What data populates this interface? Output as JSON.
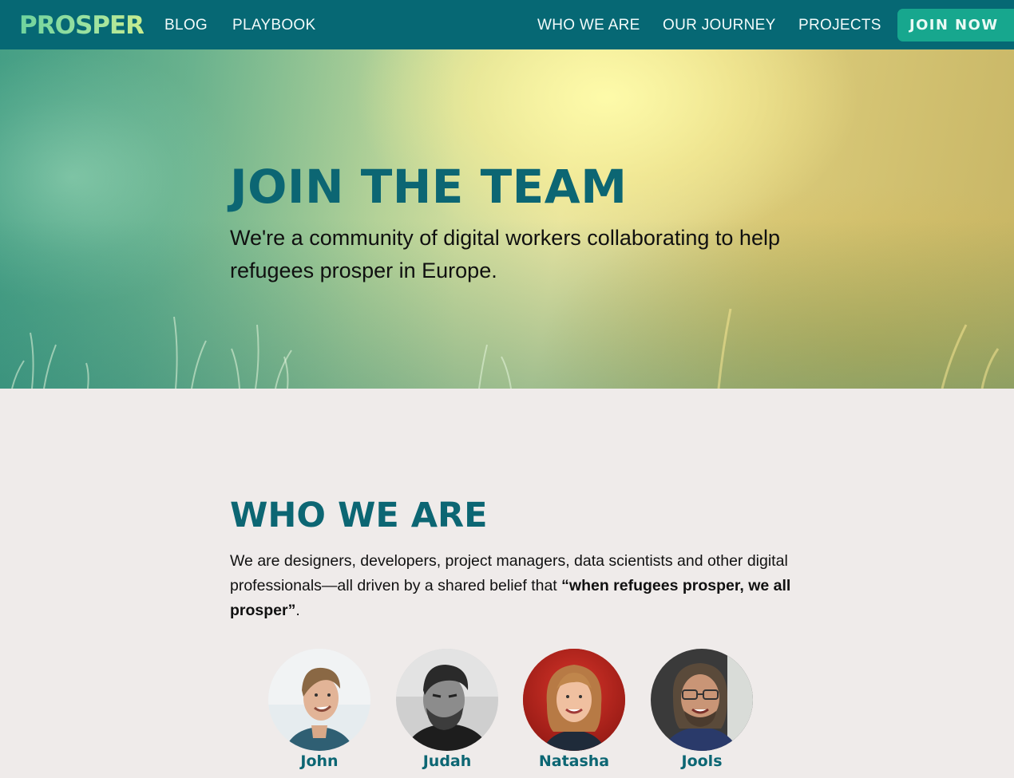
{
  "nav": {
    "logo": "PROSPER",
    "left_links": [
      {
        "label": "BLOG"
      },
      {
        "label": "PLAYBOOK"
      }
    ],
    "right_links": [
      {
        "label": "WHO WE ARE"
      },
      {
        "label": "OUR JOURNEY"
      },
      {
        "label": "PROJECTS"
      }
    ],
    "cta": "JOIN NOW"
  },
  "hero": {
    "title": "JOIN THE TEAM",
    "subtitle": "We're a community of digital workers collaborating to help refugees prosper in Europe."
  },
  "who_we_are": {
    "title": "WHO WE ARE",
    "body_intro": "We are designers, developers, project managers, data scientists and other digital professionals—all driven by a shared belief that ",
    "body_quote": "“when refugees prosper, we all prosper”",
    "body_end": ".",
    "members": [
      {
        "name": "John",
        "avatar": "photo-john"
      },
      {
        "name": "Judah",
        "avatar": "photo-judah"
      },
      {
        "name": "Natasha",
        "avatar": "photo-natasha"
      },
      {
        "name": "Jools",
        "avatar": "photo-jools"
      }
    ]
  },
  "colors": {
    "nav_bg": "#066874",
    "accent_teal": "#0c6673",
    "cta_bg": "#17a78e",
    "page_bg": "#efebea"
  }
}
